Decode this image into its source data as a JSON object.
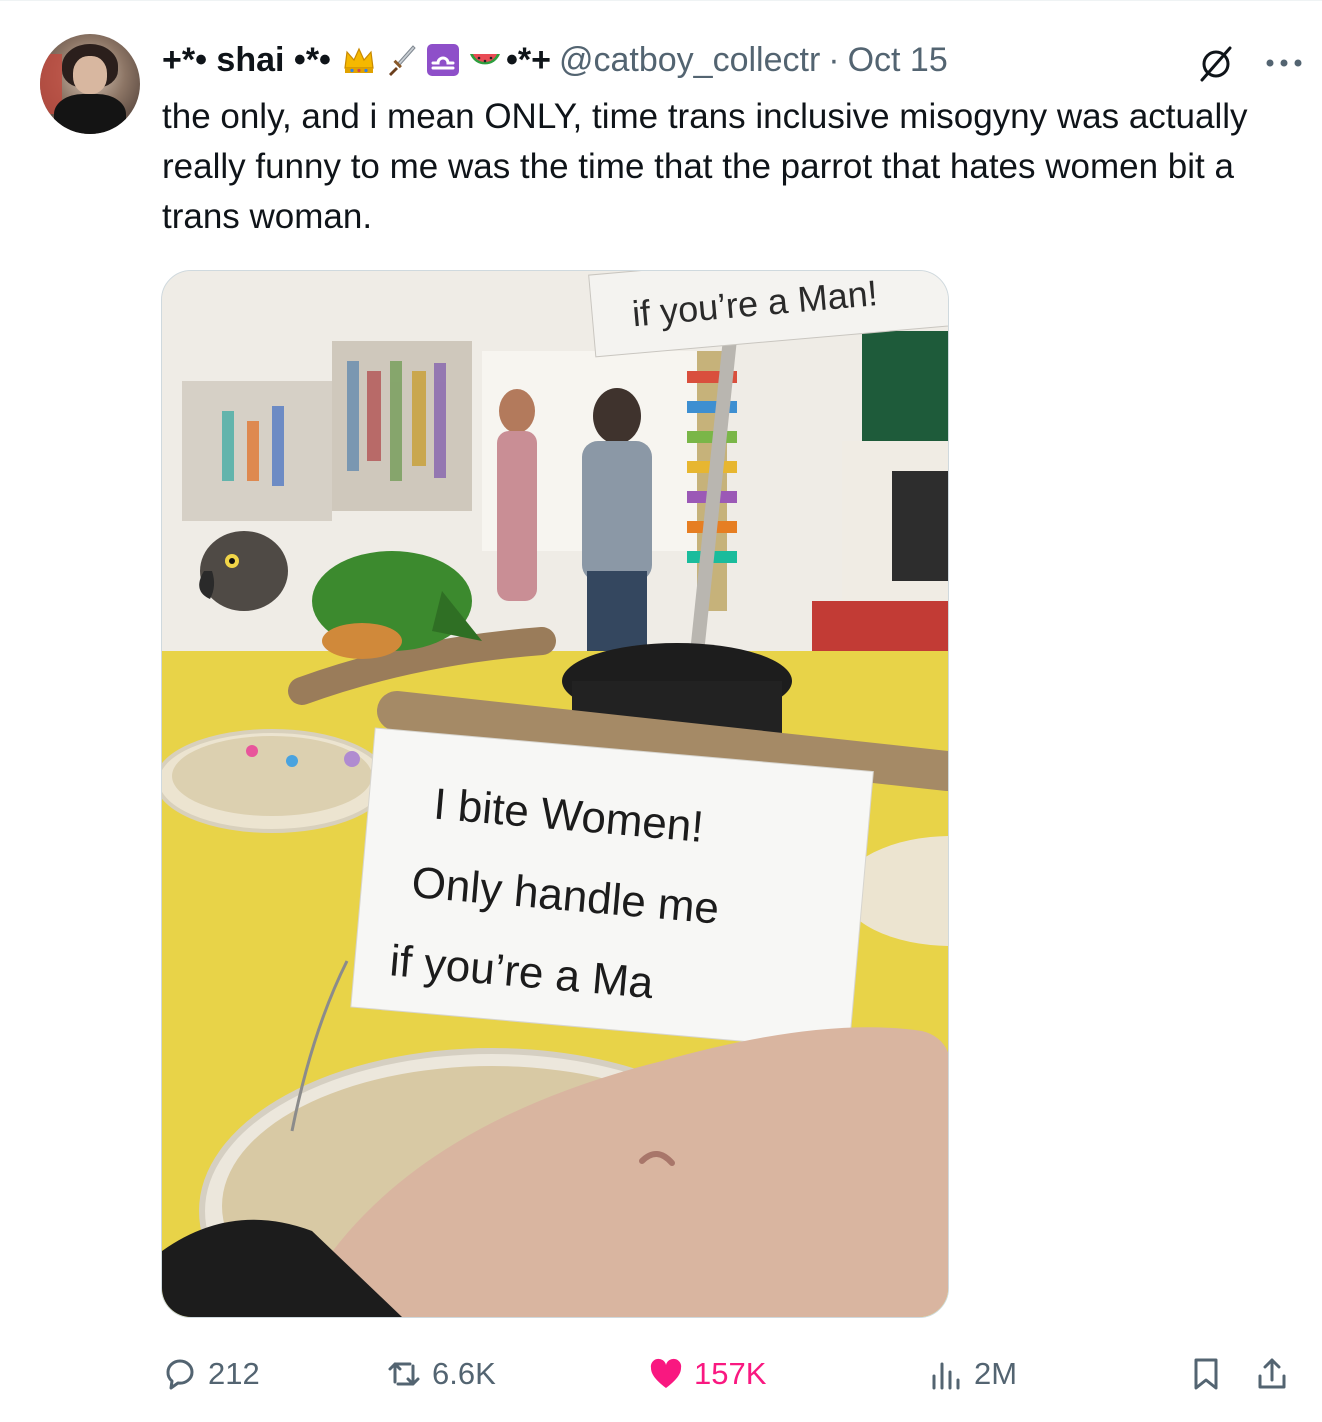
{
  "tweet": {
    "display_name_prefix": "+*• shai •*•",
    "display_name_suffix": "•*+",
    "emojis": [
      "crown-icon",
      "dagger-icon",
      "libra-icon",
      "watermelon-icon"
    ],
    "handle": "@catboy_collectr",
    "separator": "·",
    "date": "Oct 15",
    "text": "the only, and i mean ONLY, time trans inclusive misogyny was actually really funny to me was the time that the parrot that hates women bit a trans woman."
  },
  "media": {
    "sign_top_text": "if you’re a Man!",
    "sign_lines": [
      "I bite Women!",
      "Only handle me",
      "if you’re a Ma"
    ]
  },
  "actions": {
    "replies": "212",
    "reposts": "6.6K",
    "likes": "157K",
    "views": "2M"
  },
  "colors": {
    "text": "#0f1419",
    "secondary": "#536471",
    "like": "#f91880",
    "border": "#cfd9de"
  }
}
